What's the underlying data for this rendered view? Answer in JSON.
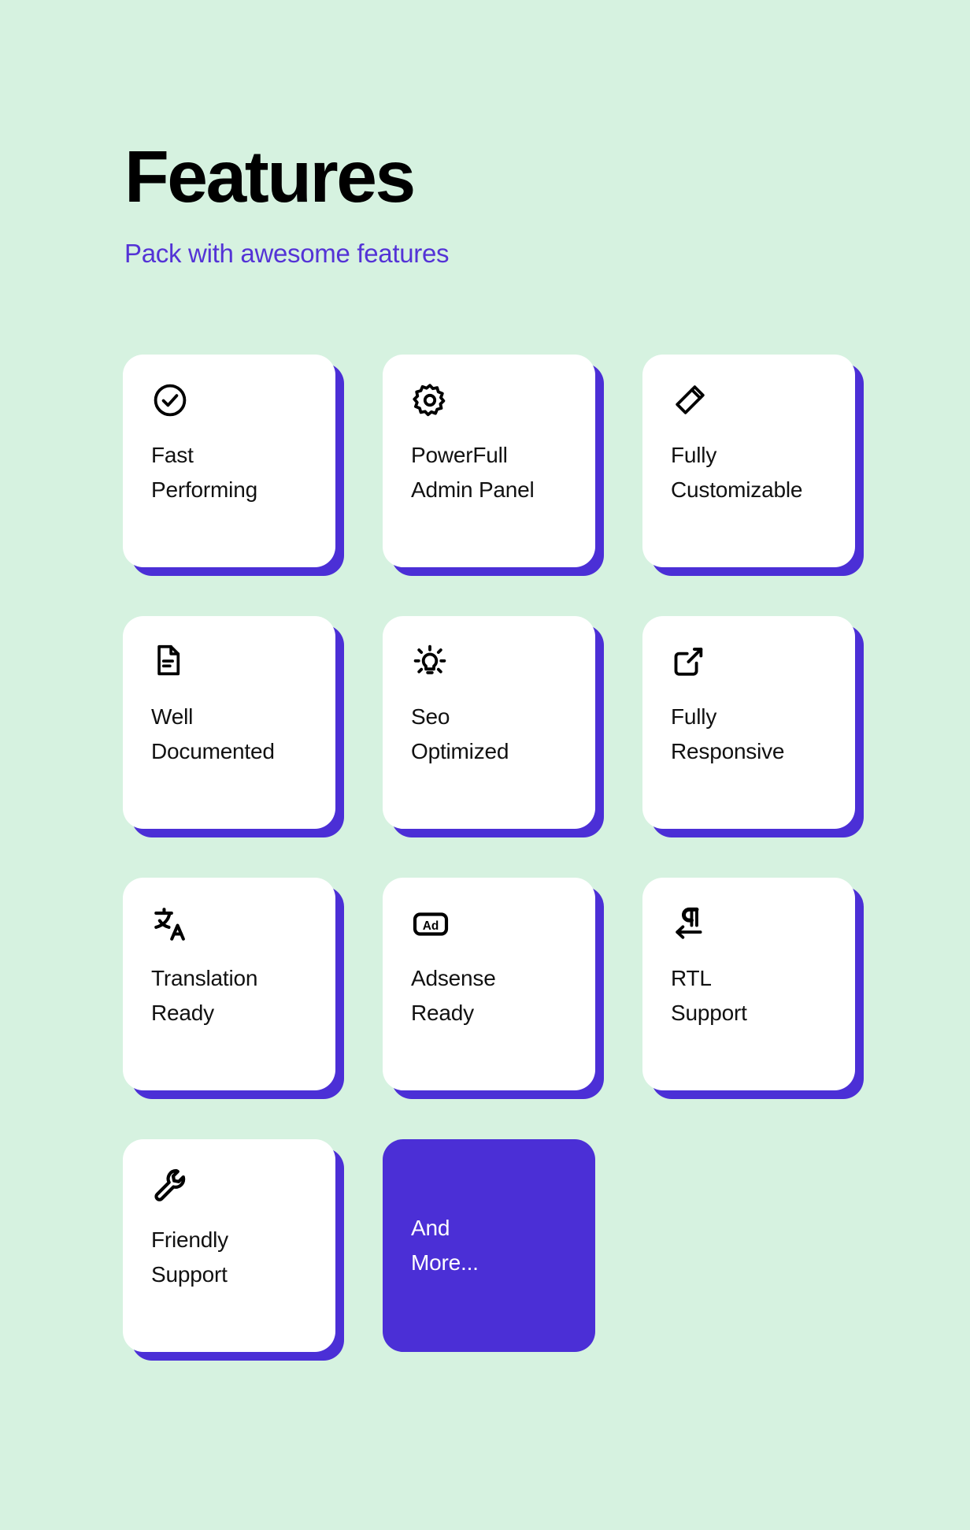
{
  "header": {
    "title": "Features",
    "subtitle": "Pack with awesome features"
  },
  "theme": {
    "background": "#d6f2e0",
    "accent": "#4b2fd6",
    "card_background": "#ffffff",
    "title_color": "#000000",
    "subtitle_color": "#5433d6",
    "label_color": "#111111"
  },
  "cards": [
    {
      "icon": "check-circle-icon",
      "label": "Fast\nPerforming",
      "style": "light"
    },
    {
      "icon": "gear-icon",
      "label": "PowerFull\nAdmin Panel",
      "style": "light"
    },
    {
      "icon": "pencil-icon",
      "label": "Fully\nCustomizable",
      "style": "light"
    },
    {
      "icon": "document-icon",
      "label": "Well\nDocumented",
      "style": "light"
    },
    {
      "icon": "lightbulb-icon",
      "label": "Seo\nOptimized",
      "style": "light"
    },
    {
      "icon": "external-link-icon",
      "label": "Fully\nResponsive",
      "style": "light"
    },
    {
      "icon": "translate-icon",
      "label": "Translation\nReady",
      "style": "light"
    },
    {
      "icon": "ad-badge-icon",
      "label": "Adsense\nReady",
      "style": "light"
    },
    {
      "icon": "rtl-pilcrow-icon",
      "label": "RTL\nSupport",
      "style": "light"
    },
    {
      "icon": "wrench-icon",
      "label": "Friendly\nSupport",
      "style": "light"
    },
    {
      "icon": "none",
      "label": "And\nMore...",
      "style": "accent"
    }
  ]
}
